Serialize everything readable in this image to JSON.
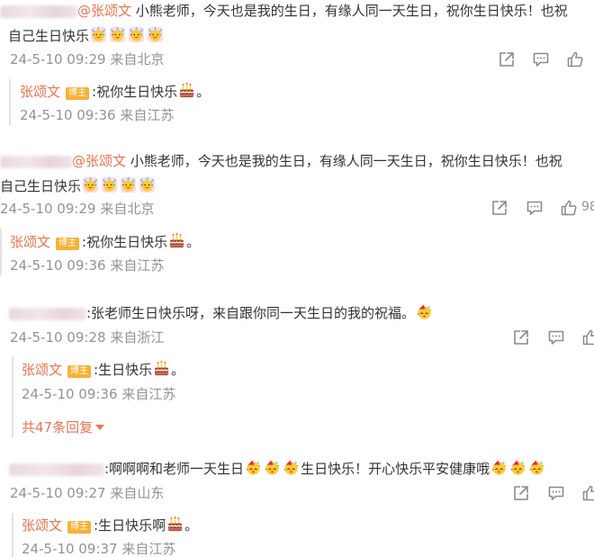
{
  "comments": [
    {
      "handle": "@张颂文",
      "text": " 小熊老师，今天也是我的生日，有缘人同一天生日，祝你生日快乐！也祝",
      "text_line2": "自己生日快乐",
      "time": "24-5-10 09:29",
      "location": "来自北京",
      "reply": {
        "user": "张颂文",
        "badge": "博主",
        "text": ":祝你生日快乐",
        "time": "24-5-10 09:36",
        "location": "来自江苏"
      }
    },
    {
      "handle": "@张颂文",
      "text": " 小熊老师，今天也是我的生日，有缘人同一天生日，祝你生日快乐！也祝",
      "text_line2": "自己生日快乐",
      "time": "24-5-10 09:29",
      "location": "来自北京",
      "like_count": "98",
      "reply": {
        "user": "张颂文",
        "badge": "博主",
        "text": ":祝你生日快乐",
        "time": "24-5-10 09:36",
        "location": "来自江苏"
      }
    },
    {
      "text": ":张老师生日快乐呀，来自跟你同一天生日的我的祝福。",
      "time": "24-5-10 09:28",
      "location": "来自浙江",
      "reply": {
        "user": "张颂文",
        "badge": "博主",
        "text": ":生日快乐",
        "time": "24-5-10 09:36",
        "location": "来自江苏"
      },
      "more_replies": "共47条回复"
    },
    {
      "text": ":啊啊啊和老师一天生日",
      "text_tail": "生日快乐！开心快乐平安健康哦",
      "time": "24-5-10 09:27",
      "location": "来自山东",
      "reply": {
        "user": "张颂文",
        "badge": "博主",
        "text": ":生日快乐啊",
        "time": "24-5-10 09:37",
        "location": "来自江苏"
      }
    }
  ],
  "icons": {
    "share": "share-icon",
    "comment": "comment-icon",
    "like": "like-icon",
    "cake": "cake-emoji",
    "celebrate": "celebrate-emoji",
    "party": "party-face-emoji"
  },
  "colors": {
    "username": "#eb7350",
    "meta": "#939393",
    "badge": "#f7b134",
    "text": "#333333"
  }
}
